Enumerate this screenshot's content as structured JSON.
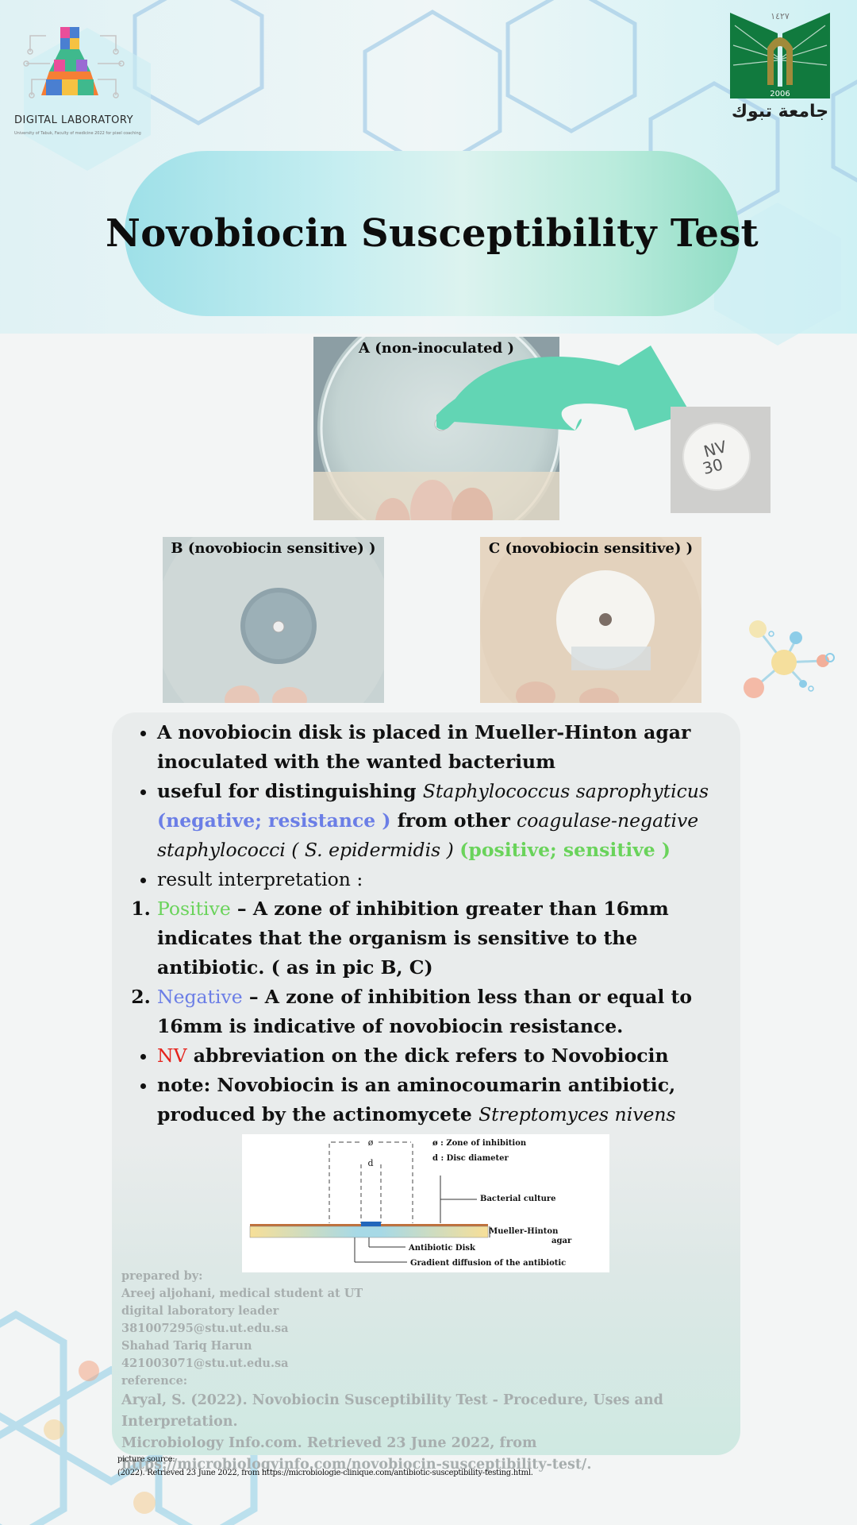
{
  "logos": {
    "left_text": "DIGITAL LABORATORY",
    "left_subtext": "University of Tabuk, Faculty of medicine 2022 for pixel coaching",
    "right_year_top": "١٤٢٧",
    "right_year": "2006",
    "right_name": "جامعة تبوك"
  },
  "title": "Novobiocin Susceptibility Test",
  "images": {
    "a_caption": "A (non-inoculated )",
    "b_caption": "B (novobiocin sensitive) )",
    "c_caption": "C (novobiocin sensitive) )",
    "disk_text_line1": "NV",
    "disk_text_line2": "30"
  },
  "content": {
    "bullet1": "A novobiocin disk is placed in Mueller-Hinton agar inoculated with the wanted bacterium",
    "bullet2_a": "useful for distinguishing ",
    "bullet2_b": "Staphylococcus saprophyticus",
    "bullet2_c": "(negative; resistance )",
    "bullet2_d": " from other ",
    "bullet2_e": "coagulase-negative staphylococci ( S. epidermidis )",
    "bullet2_f": "(positive; sensitive )",
    "bullet3": "result interpretation :",
    "ol1_a": "Positive",
    "ol1_b": " – A zone of inhibition greater than 16mm indicates that the organism is sensitive to the antibiotic. ( as in pic B, C)",
    "ol2_a": "Negative",
    "ol2_b": " – A zone of inhibition less than or equal to 16mm is indicative of novobiocin resistance.",
    "bullet4_a": "NV",
    "bullet4_b": " abbreviation on the dick refers to Novobiocin",
    "bullet5_a": " note: Novobiocin is an aminocoumarin antibiotic, produced by the actinomycete ",
    "bullet5_b": "Streptomyces nivens"
  },
  "diagram": {
    "phi": "ø",
    "legend1": "ø : Zone of inhibition",
    "legend2": "d : Disc diameter",
    "d": "d",
    "bacterial_culture": "Bacterial culture",
    "agar_line1": "4 mm of Mueller-Hinton",
    "agar_line2": "agar",
    "antibiotic_disk": "Antibiotic Disk",
    "gradient": "Gradient diffusion of the antibiotic"
  },
  "credits": {
    "l1": "prepared by:",
    "l2": "Areej aljohani, medical student at UT",
    "l3": "digital laboratory leader",
    "l4": "381007295@stu.ut.edu.sa",
    "l5": "Shahad Tariq Harun",
    "l6": "421003071@stu.ut.edu.sa",
    "l7": "reference:",
    "r1": "Aryal, S. (2022). Novobiocin Susceptibility Test - Procedure, Uses and Interpretation.",
    "r2": "Microbiology Info.com. Retrieved 23 June 2022, from",
    "r3": "https://microbiologyinfo.com/novobiocin-susceptibility-test/."
  },
  "picture_source": {
    "l1": "picture source:",
    "l2": "(2022). Retrieved 23 June 2022, from https://microbiologie-clinique.com/antibiotic-susceptibility-testing.html."
  },
  "colors": {
    "accent_blue": "#6b7ee6",
    "accent_green": "#6ad35b",
    "accent_red": "#e5231c",
    "arrow": "#62d5b4"
  }
}
